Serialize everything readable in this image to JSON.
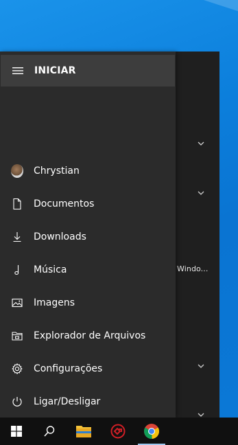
{
  "start_menu": {
    "header_title": "INICIAR",
    "items": [
      {
        "label": "Chrystian",
        "icon": "user-avatar"
      },
      {
        "label": "Documentos",
        "icon": "document-icon"
      },
      {
        "label": "Downloads",
        "icon": "download-icon"
      },
      {
        "label": "Música",
        "icon": "music-icon"
      },
      {
        "label": "Imagens",
        "icon": "image-icon"
      },
      {
        "label": "Explorador de Arquivos",
        "icon": "file-explorer-icon"
      },
      {
        "label": "Configurações",
        "icon": "gear-icon"
      },
      {
        "label": "Ligar/Desligar",
        "icon": "power-icon"
      }
    ],
    "tiles_group_label": "Windo..."
  },
  "taskbar": {
    "buttons": [
      "start-button",
      "search-button",
      "file-explorer-button",
      "app-red-button",
      "chrome-button"
    ]
  },
  "colors": {
    "nav_bg": "#2b2b2b",
    "header_bg": "#3d3d3d",
    "menu_bg": "#1f1f1f",
    "taskbar_bg": "#101010",
    "desktop_blue": "#0c7fdc"
  }
}
